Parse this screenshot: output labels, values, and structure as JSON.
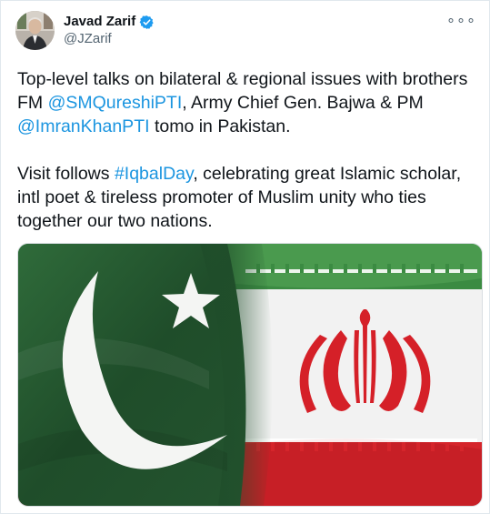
{
  "tweet": {
    "author_name": "Javad Zarif",
    "handle": "@JZarif",
    "verified_icon": "verified-badge-icon",
    "more_icon": "more-options-icon",
    "more_glyph": "∘∘∘",
    "p1_a": "Top-level talks on bilateral & regional issues with brothers FM ",
    "p1_mention1": "@SMQureshiPTI",
    "p1_b": ", Army Chief Gen. Bajwa & PM ",
    "p1_mention2": "@ImranKhanPTI",
    "p1_c": " tomo in Pakistan.",
    "p2_a": "Visit follows ",
    "p2_hashtag": "#IqbalDay",
    "p2_b": ", celebrating great Islamic scholar, intl poet & tireless promoter of Muslim unity who ties together our two nations.",
    "media_description_icon": "pakistan-iran-flags-image",
    "link_color": "#1b95e0",
    "verified_color": "#1d9bf0"
  }
}
